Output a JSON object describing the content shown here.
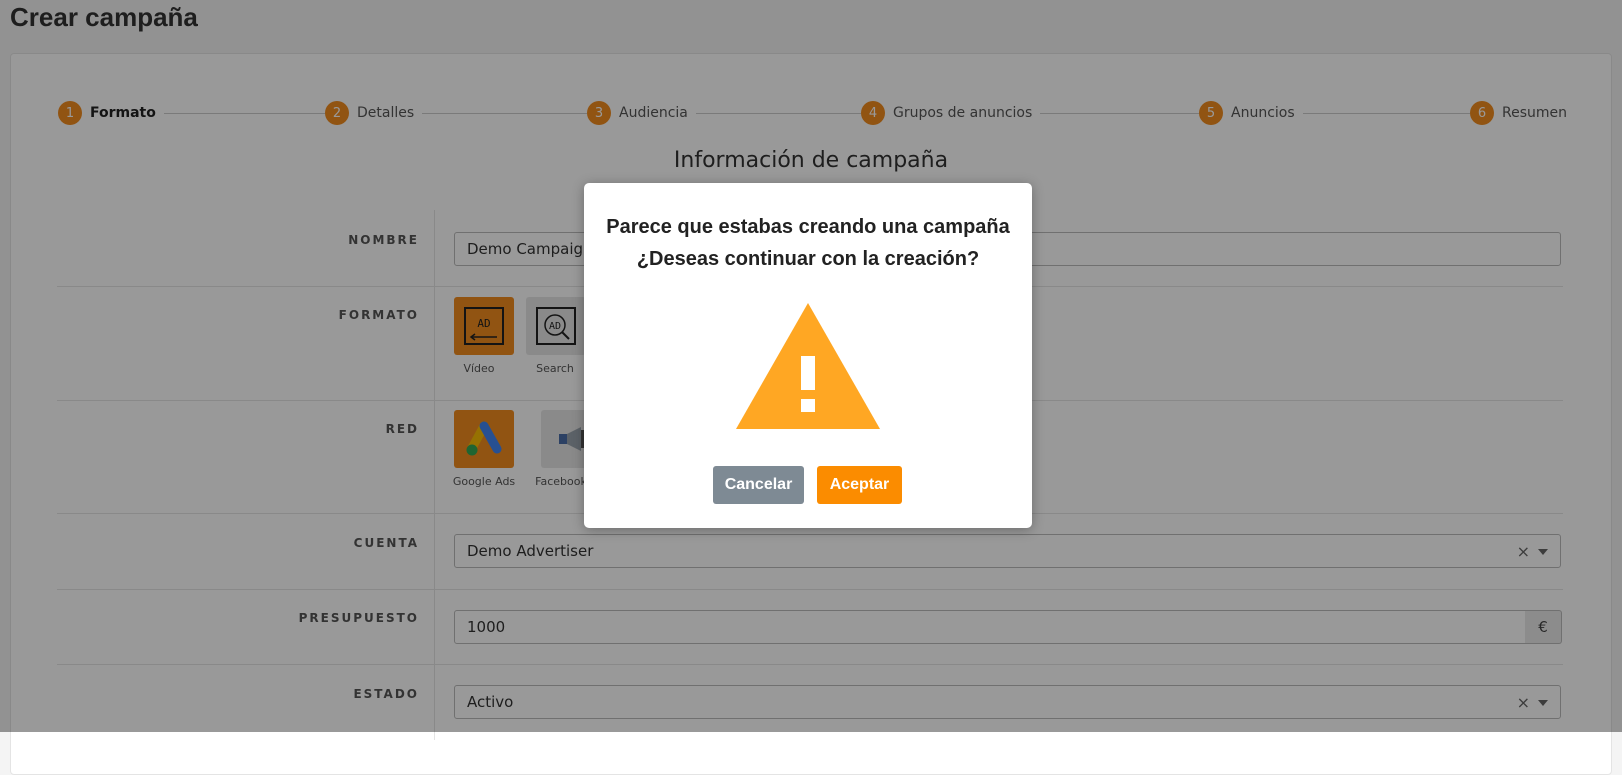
{
  "page": {
    "title": "Crear campaña"
  },
  "stepper": {
    "steps": [
      {
        "num": "1",
        "label": "Formato"
      },
      {
        "num": "2",
        "label": "Detalles"
      },
      {
        "num": "3",
        "label": "Audiencia"
      },
      {
        "num": "4",
        "label": "Grupos de anuncios"
      },
      {
        "num": "5",
        "label": "Anuncios"
      },
      {
        "num": "6",
        "label": "Resumen"
      }
    ],
    "active_step": 1
  },
  "form": {
    "section_title": "Información de campaña",
    "nombre": {
      "label": "NOMBRE",
      "value": "Demo Campaign"
    },
    "formato": {
      "label": "FORMATO",
      "options": [
        {
          "label": "Vídeo",
          "icon": "ad-video-icon",
          "selected": true
        },
        {
          "label": "Search",
          "icon": "ad-search-icon",
          "selected": false
        }
      ]
    },
    "red": {
      "label": "RED",
      "options": [
        {
          "label": "Google Ads",
          "icon": "google-ads-icon",
          "selected": true
        },
        {
          "label": "Facebook",
          "icon": "megaphone-icon",
          "selected": false
        }
      ]
    },
    "cuenta": {
      "label": "CUENTA",
      "value": "Demo Advertiser"
    },
    "presupuesto": {
      "label": "PRESUPUESTO",
      "value": "1000",
      "currency": "€"
    },
    "estado": {
      "label": "ESTADO",
      "value": "Activo"
    },
    "clear_symbol": "×"
  },
  "modal": {
    "line1": "Parece que estabas creando una campaña",
    "line2": "¿Deseas continuar con la creación?",
    "icon": "warning-icon",
    "cancel_label": "Cancelar",
    "accept_label": "Aceptar"
  },
  "colors": {
    "accent": "#f28c1e",
    "warning": "#ffa723",
    "cancel": "#7e8a94",
    "accept": "#fb8c00"
  }
}
